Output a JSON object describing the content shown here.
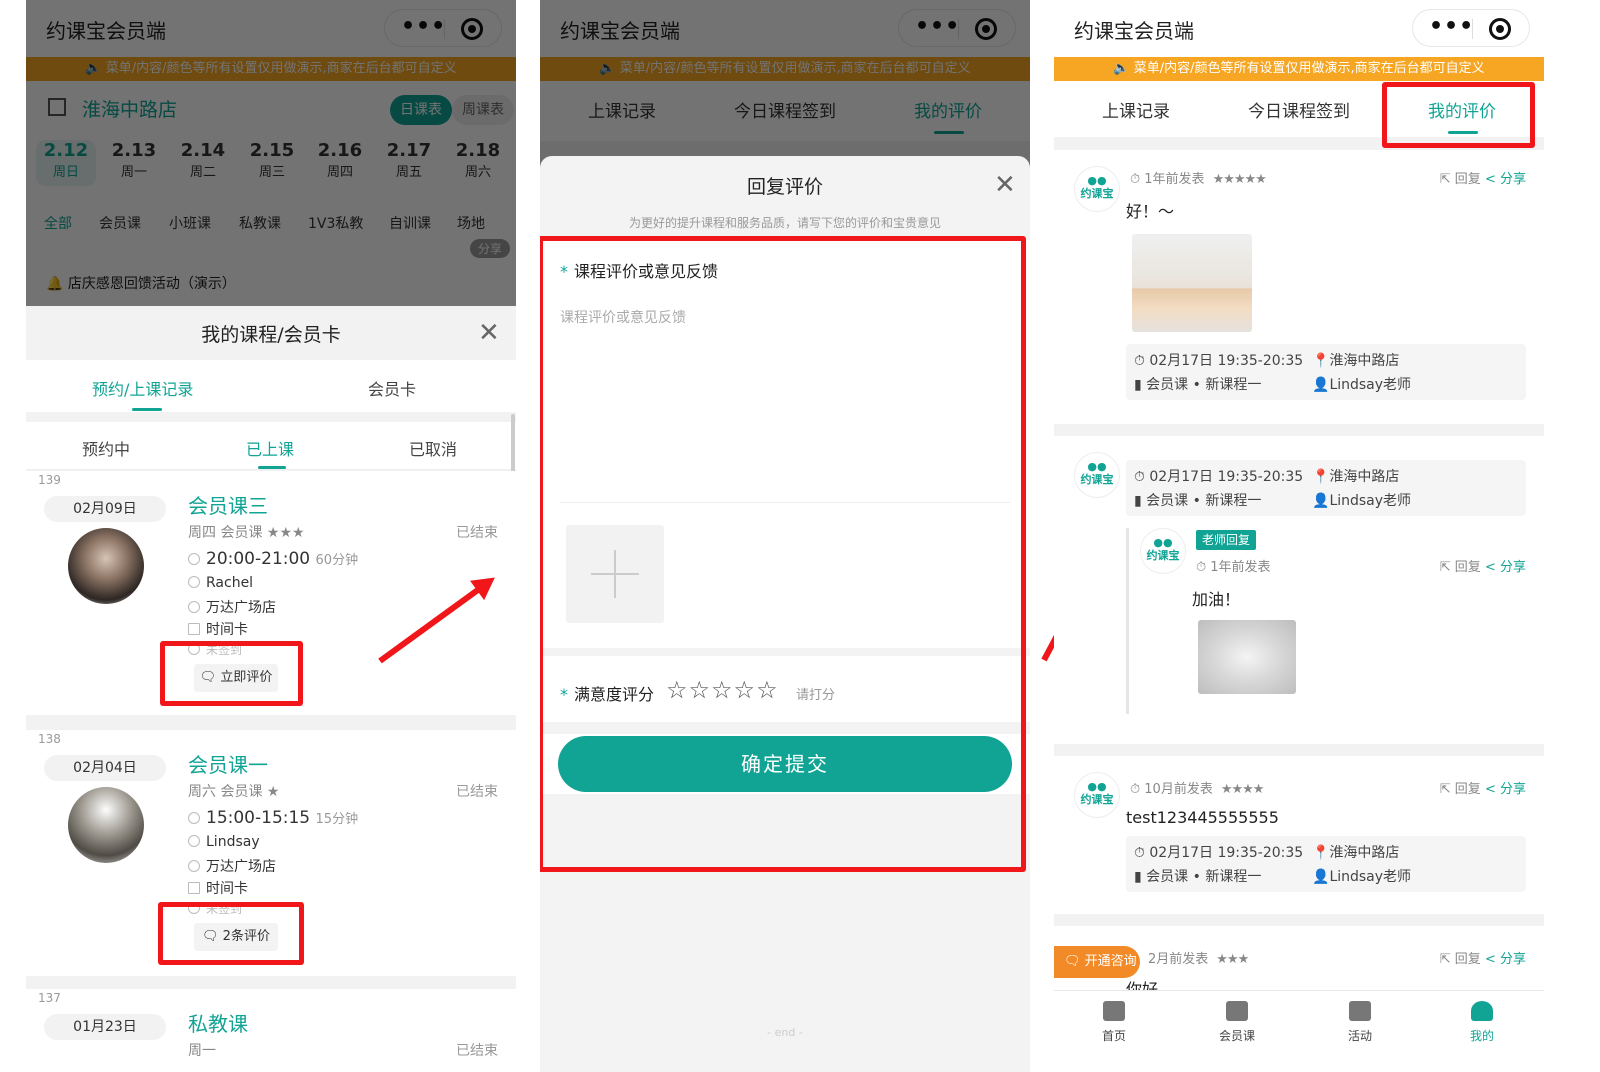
{
  "app_title": "约课宝会员端",
  "notice": "菜单/内容/颜色等所有设置仅用做演示,商家在后台都可自定义",
  "panel1": {
    "store": "淮海中路店",
    "view_tabs": [
      "日课表",
      "周课表"
    ],
    "dates": [
      {
        "d": "2.12",
        "w": "周日"
      },
      {
        "d": "2.13",
        "w": "周一"
      },
      {
        "d": "2.14",
        "w": "周二"
      },
      {
        "d": "2.15",
        "w": "周三"
      },
      {
        "d": "2.16",
        "w": "周四"
      },
      {
        "d": "2.17",
        "w": "周五"
      },
      {
        "d": "2.18",
        "w": "周六"
      }
    ],
    "categories": [
      "全部",
      "会员课",
      "小班课",
      "私教课",
      "1V3私教",
      "自训课",
      "场地"
    ],
    "share": "分享",
    "announcement": "店庆感恩回馈活动（演示）",
    "sheet_title": "我的课程/会员卡",
    "main_tabs": [
      "预约/上课记录",
      "会员卡"
    ],
    "sub_tabs": [
      "预约中",
      "已上课",
      "已取消"
    ],
    "courses": [
      {
        "num": "139",
        "date": "02月09日",
        "title": "会员课三",
        "sub": "周四 会员课 ★★★",
        "status": "已结束",
        "time": "20:00-21:00",
        "duration": "60分钟",
        "coach": "Rachel",
        "venue": "万达广场店",
        "card": "时间卡",
        "sign": "未签到",
        "button": "立即评价"
      },
      {
        "num": "138",
        "date": "02月04日",
        "title": "会员课一",
        "sub": "周六 会员课 ★",
        "status": "已结束",
        "time": "15:00-15:15",
        "duration": "15分钟",
        "coach": "Lindsay",
        "venue": "万达广场店",
        "card": "时间卡",
        "sign": "未签到",
        "button": "2条评价"
      },
      {
        "num": "137",
        "date": "01月23日",
        "title": "私教课",
        "sub": "周一",
        "status": "已结束"
      }
    ]
  },
  "panel2": {
    "tabs": [
      "上课记录",
      "今日课程签到",
      "我的评价"
    ],
    "modal_title": "回复评价",
    "hint": "为更好的提升课程和服务品质，请写下您的评价和宝贵意见",
    "field_label": "课程评价或意见反馈",
    "placeholder": "课程评价或意见反馈",
    "rating_label": "满意度评分",
    "rating_stars": "☆☆☆☆☆",
    "rating_hint": "请打分",
    "submit": "确定提交",
    "end": "- end -"
  },
  "panel3": {
    "tabs": [
      "上课记录",
      "今日课程签到",
      "我的评价"
    ],
    "logo_text": "约课宝",
    "reply": "回复",
    "share": "分享",
    "teacher_badge": "老师回复",
    "reviews": [
      {
        "time": "1年前发表",
        "stars": "★★★★★",
        "text": "好！～",
        "slot": "02月17日 19:35-20:35",
        "store": "淮海中路店",
        "course": "会员课 • 新课程一",
        "teacher": "Lindsay老师"
      },
      {
        "slot": "02月17日 19:35-20:35",
        "store": "淮海中路店",
        "course": "会员课 • 新课程一",
        "teacher": "Lindsay老师",
        "reply_time": "1年前发表",
        "reply_text": "加油！"
      },
      {
        "time": "10月前发表",
        "stars": "★★★★",
        "text": "test123445555555",
        "slot": "02月17日 19:35-20:35",
        "store": "淮海中路店",
        "course": "会员课 • 新课程一",
        "teacher": "Lindsay老师"
      },
      {
        "time": "2月前发表",
        "stars": "★★★",
        "text": "你好"
      }
    ],
    "consult": "开通咨询",
    "nav": [
      "首页",
      "会员课",
      "活动",
      "我的"
    ]
  },
  "colors": {
    "accent": "#11a495",
    "highlight": "#f0161a",
    "notice": "#f6a623"
  }
}
